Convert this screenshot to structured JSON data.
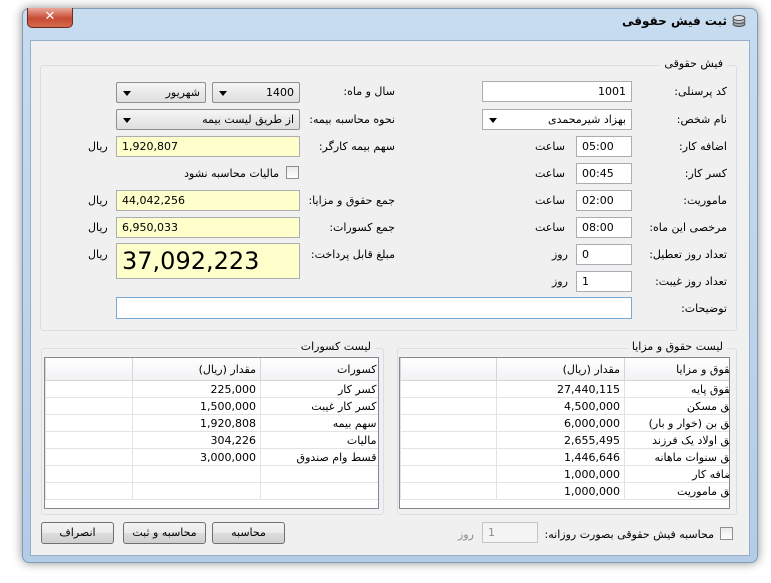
{
  "window": {
    "title": "ثبت فیش حقوقی",
    "close_symbol": "✕"
  },
  "form": {
    "group_title": "فیش حقوقی",
    "personnel_code": {
      "label": "کد پرسنلی:",
      "value": "1001"
    },
    "person_name": {
      "label": "نام شخص:",
      "value": "بهزاد شیرمحمدی"
    },
    "overtime": {
      "label": "اضافه کار:",
      "value": "05:00",
      "unit": "ساعت"
    },
    "undertime": {
      "label": "کسر کار:",
      "value": "00:45",
      "unit": "ساعت"
    },
    "mission": {
      "label": "ماموریت:",
      "value": "02:00",
      "unit": "ساعت"
    },
    "leave": {
      "label": "مرخصی این ماه:",
      "value": "08:00",
      "unit": "ساعت"
    },
    "holidays": {
      "label": "تعداد روز تعطیل:",
      "value": "0",
      "unit": "روز"
    },
    "absence": {
      "label": "تعداد روز غیبت:",
      "value": "1",
      "unit": "روز"
    },
    "notes": {
      "label": "توضیحات:",
      "value": ""
    },
    "year_month": {
      "label": "سال و ماه:",
      "year": "1400",
      "month": "شهریور"
    },
    "insurance_method": {
      "label": "نحوه محاسبه بیمه:",
      "value": "از طریق لیست بیمه"
    },
    "employee_insurance": {
      "label": "سهم بیمه کارگر:",
      "value": "1,920,807",
      "unit": "ریال"
    },
    "no_tax": {
      "label": "مالیات محاسبه نشود",
      "checked": false
    },
    "total_earnings": {
      "label": "جمع حقوق و مزایا:",
      "value": "44,042,256",
      "unit": "ریال"
    },
    "total_deductions": {
      "label": "جمع کسورات:",
      "value": "6,950,033",
      "unit": "ریال"
    },
    "payable": {
      "label": "مبلغ قابل پرداخت:",
      "value": "37,092,223",
      "unit": "ریال"
    }
  },
  "earnings": {
    "group_title": "لیست حقوق و مزایا",
    "headers": {
      "name": "حقوق و مزایا",
      "amount": "مقدار (ریال)"
    },
    "rows": [
      {
        "name": "حقوق پایه",
        "amount": "27,440,115"
      },
      {
        "name": "حق مسکن",
        "amount": "4,500,000"
      },
      {
        "name": "حق بن (خوار و بار)",
        "amount": "6,000,000"
      },
      {
        "name": "حق اولاد یک فرزند",
        "amount": "2,655,495"
      },
      {
        "name": "حق سنوات ماهانه",
        "amount": "1,446,646"
      },
      {
        "name": "اضافه کار",
        "amount": "1,000,000"
      },
      {
        "name": "حق ماموریت",
        "amount": "1,000,000"
      }
    ]
  },
  "deductions": {
    "group_title": "لیست کسورات",
    "headers": {
      "name": "کسورات",
      "amount": "مقدار (ریال)"
    },
    "rows": [
      {
        "name": "کسر کار",
        "amount": "225,000"
      },
      {
        "name": "کسر کار غیبت",
        "amount": "1,500,000"
      },
      {
        "name": "سهم بیمه",
        "amount": "1,920,808"
      },
      {
        "name": "مالیات",
        "amount": "304,226"
      },
      {
        "name": "قسط وام صندوق",
        "amount": "3,000,000"
      }
    ]
  },
  "footer": {
    "daily_calc": {
      "label": "محاسبه فیش حقوقی بصورت روزانه:",
      "checked": false
    },
    "days": {
      "value": "1",
      "unit": "روز"
    },
    "calc_button": "محاسبه",
    "calc_save_button": "محاسبه و ثبت",
    "cancel_button": "انصراف"
  }
}
